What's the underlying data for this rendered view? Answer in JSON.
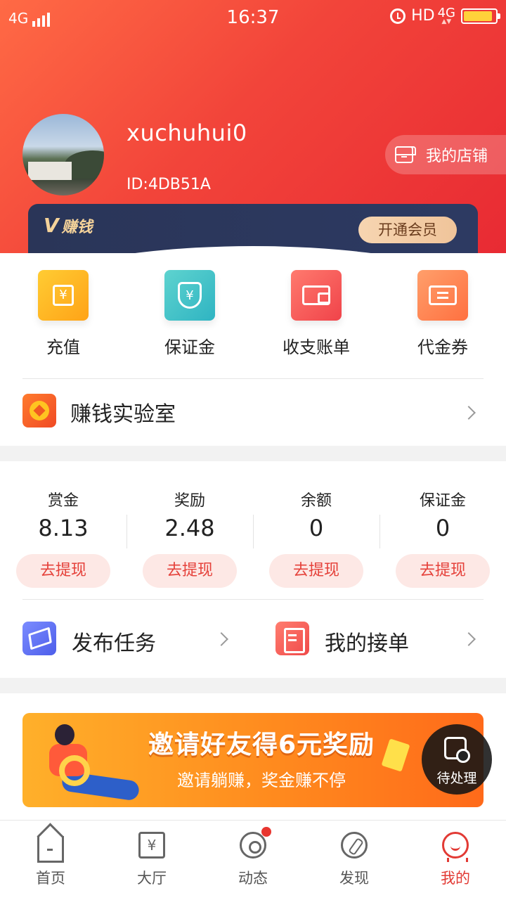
{
  "status_bar": {
    "network_left": "4G",
    "time": "16:37",
    "hd": "HD",
    "network_right": "4G",
    "battery_level": 0.92
  },
  "profile": {
    "username": "xuchuhui0",
    "user_id": "ID:4DB51A",
    "shop_button": "我的店铺"
  },
  "vip": {
    "logo_mark": "V",
    "logo_text": "赚钱",
    "open_button": "开通会员"
  },
  "quick_actions": [
    {
      "label": "充值",
      "icon": "recharge-icon"
    },
    {
      "label": "保证金",
      "icon": "shield-yen-icon"
    },
    {
      "label": "收支账单",
      "icon": "wallet-icon"
    },
    {
      "label": "代金券",
      "icon": "coupon-icon"
    }
  ],
  "lab": {
    "label": "赚钱实验室",
    "icon": "lab-icon"
  },
  "balances": [
    {
      "label": "赏金",
      "value": "8.13",
      "button": "去提现"
    },
    {
      "label": "奖励",
      "value": "2.48",
      "button": "去提现"
    },
    {
      "label": "余额",
      "value": "0",
      "button": "去提现"
    },
    {
      "label": "保证金",
      "value": "0",
      "button": "去提现"
    }
  ],
  "tasks": {
    "publish": {
      "label": "发布任务",
      "icon": "paper-plane-icon"
    },
    "orders": {
      "label": "我的接单",
      "icon": "order-list-icon"
    }
  },
  "banner": {
    "title": "邀请好友得6元奖励",
    "subtitle": "邀请躺赚，奖金赚不停"
  },
  "pending": {
    "label": "待处理",
    "icon": "pending-icon"
  },
  "tabbar": {
    "items": [
      {
        "label": "首页",
        "icon": "home-icon"
      },
      {
        "label": "大厅",
        "icon": "hall-icon",
        "glyph": "¥"
      },
      {
        "label": "动态",
        "icon": "activity-icon"
      },
      {
        "label": "发现",
        "icon": "compass-icon"
      },
      {
        "label": "我的",
        "icon": "profile-icon"
      }
    ],
    "active_index": 4,
    "accent": "#e23a34"
  }
}
